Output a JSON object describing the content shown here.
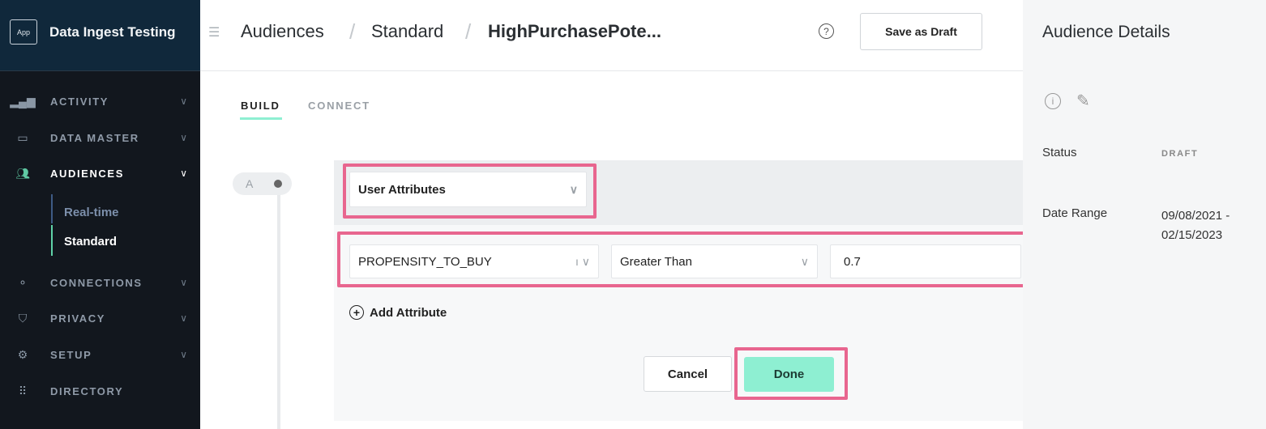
{
  "app": {
    "logo": "App",
    "name": "Data Ingest Testing"
  },
  "sidebar": {
    "items": [
      {
        "label": "ACTIVITY",
        "icon": "bar-chart-icon"
      },
      {
        "label": "DATA MASTER",
        "icon": "data-master-icon"
      },
      {
        "label": "AUDIENCES",
        "icon": "people-icon",
        "active": true
      },
      {
        "label": "CONNECTIONS",
        "icon": "connections-icon"
      },
      {
        "label": "PRIVACY",
        "icon": "shield-icon"
      },
      {
        "label": "SETUP",
        "icon": "gear-icon"
      },
      {
        "label": "DIRECTORY",
        "icon": "grid-icon"
      }
    ],
    "subitems": [
      {
        "label": "Real-time"
      },
      {
        "label": "Standard",
        "active": true
      }
    ]
  },
  "header": {
    "breadcrumb": [
      "Audiences",
      "Standard",
      "HighPurchasePote..."
    ],
    "help": "?",
    "save_draft": "Save as Draft"
  },
  "tabs": [
    {
      "label": "BUILD",
      "active": true
    },
    {
      "label": "CONNECT"
    }
  ],
  "builder": {
    "node_label": "A",
    "source_select": "User Attributes",
    "attribute": "PROPENSITY_TO_BUY",
    "operator": "Greater Than",
    "value": "0.7",
    "add_attribute": "Add Attribute",
    "cancel": "Cancel",
    "done": "Done"
  },
  "details": {
    "title": "Audience Details",
    "status_label": "Status",
    "status_value": "DRAFT",
    "date_label": "Date Range",
    "date_value": "09/08/2021 - 02/15/2023"
  },
  "colors": {
    "accent": "#8eefd2",
    "highlight": "#e8668f",
    "sidebar": "#12171e"
  }
}
